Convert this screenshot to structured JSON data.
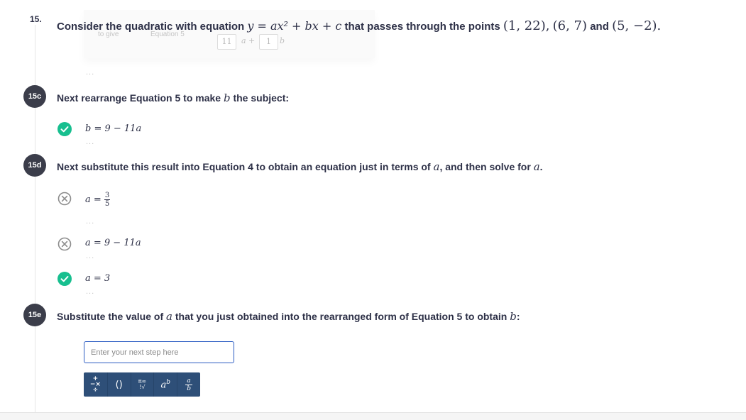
{
  "question": {
    "number": "15.",
    "text_before": "Consider the quadratic with equation",
    "equation": "y = ax² + bx + c",
    "text_middle": "that passes through the points",
    "point1": "(1, 22)",
    "point2": "(6, 7)",
    "and_label": "and",
    "point3": "(5, −2)",
    "period": "."
  },
  "faded_background": {
    "label1": "to give",
    "label2": "Equation 5",
    "coef_a": "11",
    "var_a": "a +",
    "coef_b": "1",
    "var_b": "b"
  },
  "ellipsis": "...",
  "part_c": {
    "badge": "15c",
    "prompt_before": "Next rearrange Equation 5 to make",
    "prompt_var": "b",
    "prompt_after": "the subject:",
    "answer": "b = 9 − 11a",
    "status": "correct"
  },
  "part_d": {
    "badge": "15d",
    "prompt_before": "Next substitute this result into Equation 4 to obtain an equation just in terms of",
    "prompt_var1": "a",
    "prompt_middle": ", and then solve for",
    "prompt_var2": "a",
    "prompt_end": ".",
    "attempts": [
      {
        "lhs": "a =",
        "num": "3",
        "den": "5",
        "status": "incorrect"
      },
      {
        "text": "a = 9 − 11a",
        "status": "incorrect"
      },
      {
        "text": "a = 3",
        "status": "correct"
      }
    ]
  },
  "part_e": {
    "badge": "15e",
    "prompt_before": "Substitute the value of",
    "prompt_var1": "a",
    "prompt_middle": "that you just obtained into the rearranged form of Equation 5 to obtain",
    "prompt_var2": "b",
    "prompt_end": ":",
    "input_placeholder": "Enter your next step here",
    "input_value": ""
  },
  "keypad": {
    "operators": "+−×÷",
    "brackets": "()",
    "special": "π∞ !√",
    "power_base": "a",
    "power_exp": "b",
    "fraction_num": "a",
    "fraction_den": "b"
  },
  "colors": {
    "correct": "#17bf8f",
    "incorrect_stroke": "#8c8c8c",
    "badge": "#3b3d4a",
    "keypad": "#2e4f78",
    "input_border": "#2a5bc2"
  }
}
